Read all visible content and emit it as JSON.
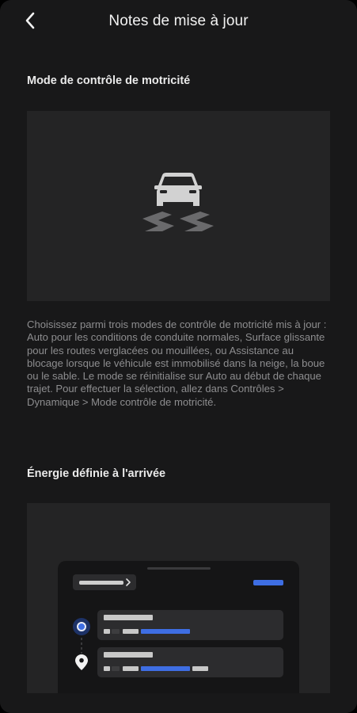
{
  "header": {
    "title": "Notes de mise à jour",
    "back_icon": "chevron-left-icon"
  },
  "sections": [
    {
      "heading": "Mode de contrôle de motricité",
      "illustration_icon": "car-slippery-road-icon",
      "body": "Choisissez parmi trois modes de contrôle de motricité mis à jour : Auto pour les conditions de conduite normales, Surface glissante pour les routes verglacées ou mouillées, ou Assistance au blocage lorsque le véhicule est immobilisé dans la neige, la boue ou le sable. Le mode se réinitialise sur Auto au début de chaque trajet. Pour effectuer la sélection, allez dans Contrôles > Dynamique > Mode contrôle de motricité."
    },
    {
      "heading": "Énergie définie à l'arrivée",
      "illustration_icon": "trip-planner-mockup"
    }
  ],
  "colors": {
    "background": "#181819",
    "panel": "#242425",
    "text_heading": "#eaeaea",
    "text_body": "#8d8d8f",
    "accent_blue": "#3e6ee3"
  }
}
